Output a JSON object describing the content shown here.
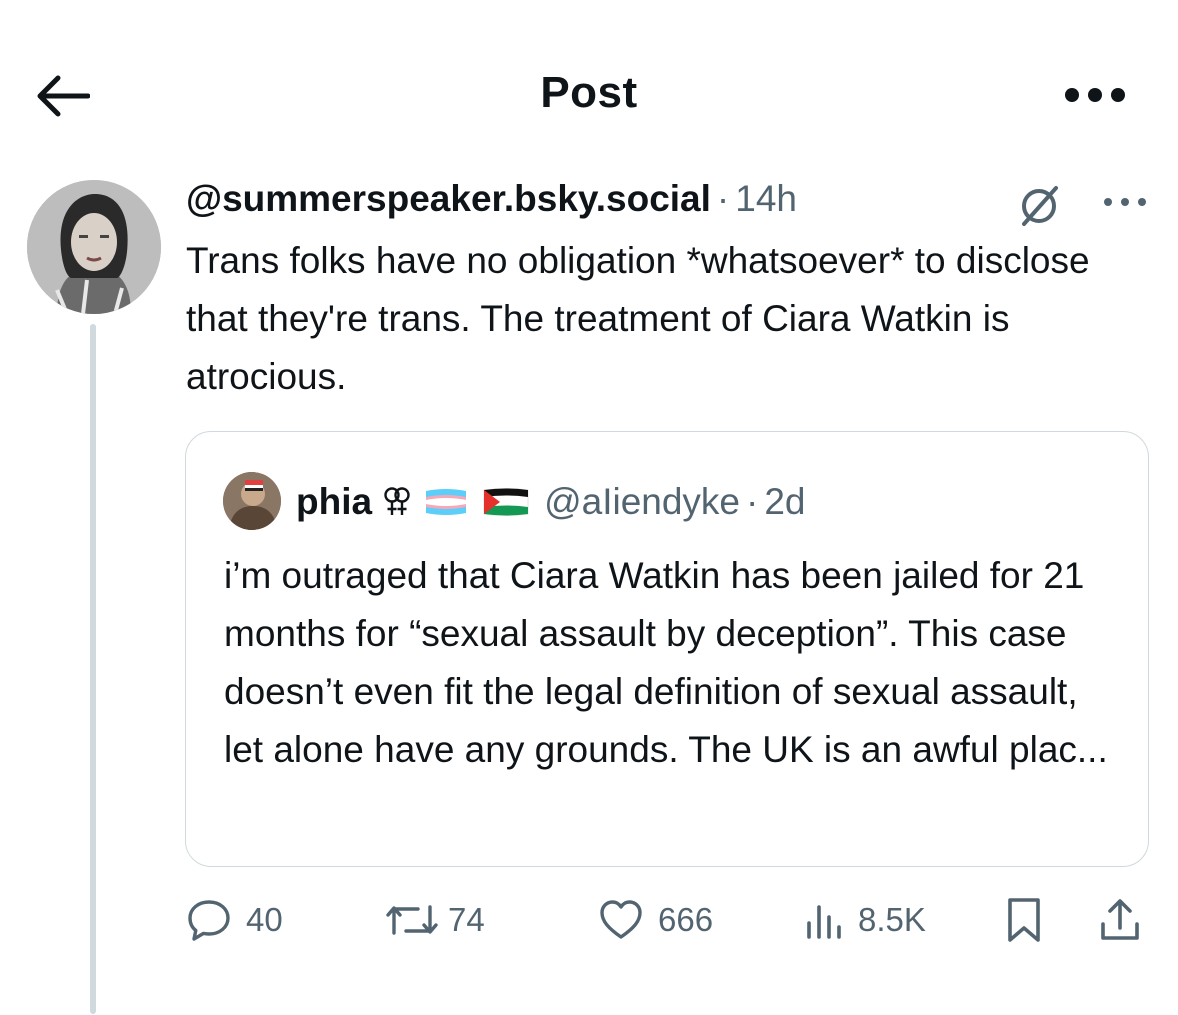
{
  "header": {
    "title": "Post",
    "back_icon": "arrow-left-icon",
    "more_icon": "more-horizontal-icon"
  },
  "post": {
    "handle": "@summerspeaker.bsky.social",
    "separator": "·",
    "time": "14h",
    "bridge_icon": "bridged-no-sign-icon",
    "text": "Trans folks have no obligation *whatsoever* to disclose that they're trans. The treatment of Ciara Watkin is atrocious."
  },
  "quote": {
    "name": "phia",
    "name_symbols": [
      "lesbian-symbol-icon",
      "trans-flag-icon",
      "palestine-flag-icon"
    ],
    "handle": "@aIiendyke",
    "separator": "·",
    "time": "2d",
    "text": "i’m outraged that Ciara Watkin has been jailed for 21 months for “sexual assault by deception”. This case doesn’t even fit the legal definition of sexual assault, let alone have any grounds. The UK is an awful plac..."
  },
  "actions": {
    "replies": "40",
    "reposts": "74",
    "likes": "666",
    "views": "8.5K"
  },
  "colors": {
    "text": "#0f1419",
    "muted": "#536471",
    "border": "#cfd9de",
    "trans_blue": "#5bcefa",
    "trans_pink": "#f5a9b8",
    "palestine_green": "#149954",
    "palestine_red": "#e4312b"
  }
}
